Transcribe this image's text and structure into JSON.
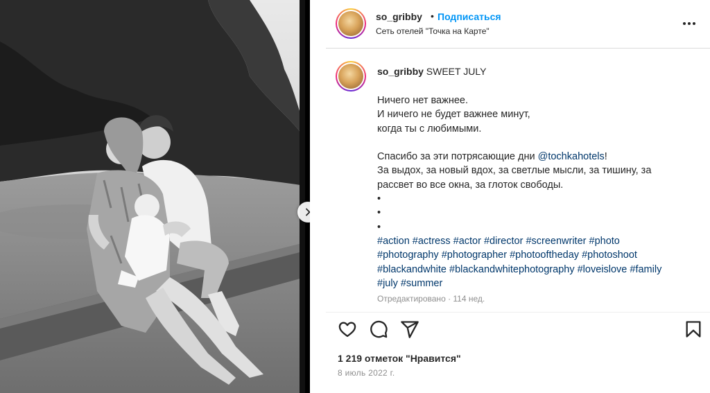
{
  "post": {
    "username": "so_gribby",
    "separator": "•",
    "follow_label": "Подписаться",
    "location": "Сеть отелей \"Точка на Карте\""
  },
  "caption": {
    "username": "so_gribby",
    "title": "SWEET JULY",
    "lines": [
      "Ничего нет важнее.",
      "И ничего не будет важнее минут,",
      "когда ты с любимыми.",
      "",
      "Спасибо за эти потрясающие дни ",
      "За выдох, за новый вдох, за светлые мысли, за тишину, за",
      "рассвет во все окна, за глоток свободы.",
      "•",
      "•",
      "•"
    ],
    "mention": "@tochkahotels",
    "mention_suffix": "!",
    "hashtags": [
      [
        "#action",
        "#actress",
        "#actor",
        "#director",
        "#screenwriter",
        "#photo"
      ],
      [
        "#photography",
        "#photographer",
        "#photooftheday",
        "#photoshoot"
      ],
      [
        "#blackandwhite",
        "#blackandwhitephotography",
        "#loveislove",
        "#family"
      ],
      [
        "#july",
        "#summer"
      ]
    ],
    "edited": "Отредактировано · 114 нед."
  },
  "stats": {
    "likes": "1 219 отметок \"Нравится\"",
    "date": "8 июль 2022 г."
  },
  "icons": {
    "like": "heart-icon",
    "comment": "comment-icon",
    "share": "share-icon",
    "save": "bookmark-icon",
    "more": "more-icon",
    "next": "chevron-right-icon"
  },
  "colors": {
    "follow": "#0095f6",
    "link": "#00376b",
    "muted": "#8e8e8e"
  }
}
